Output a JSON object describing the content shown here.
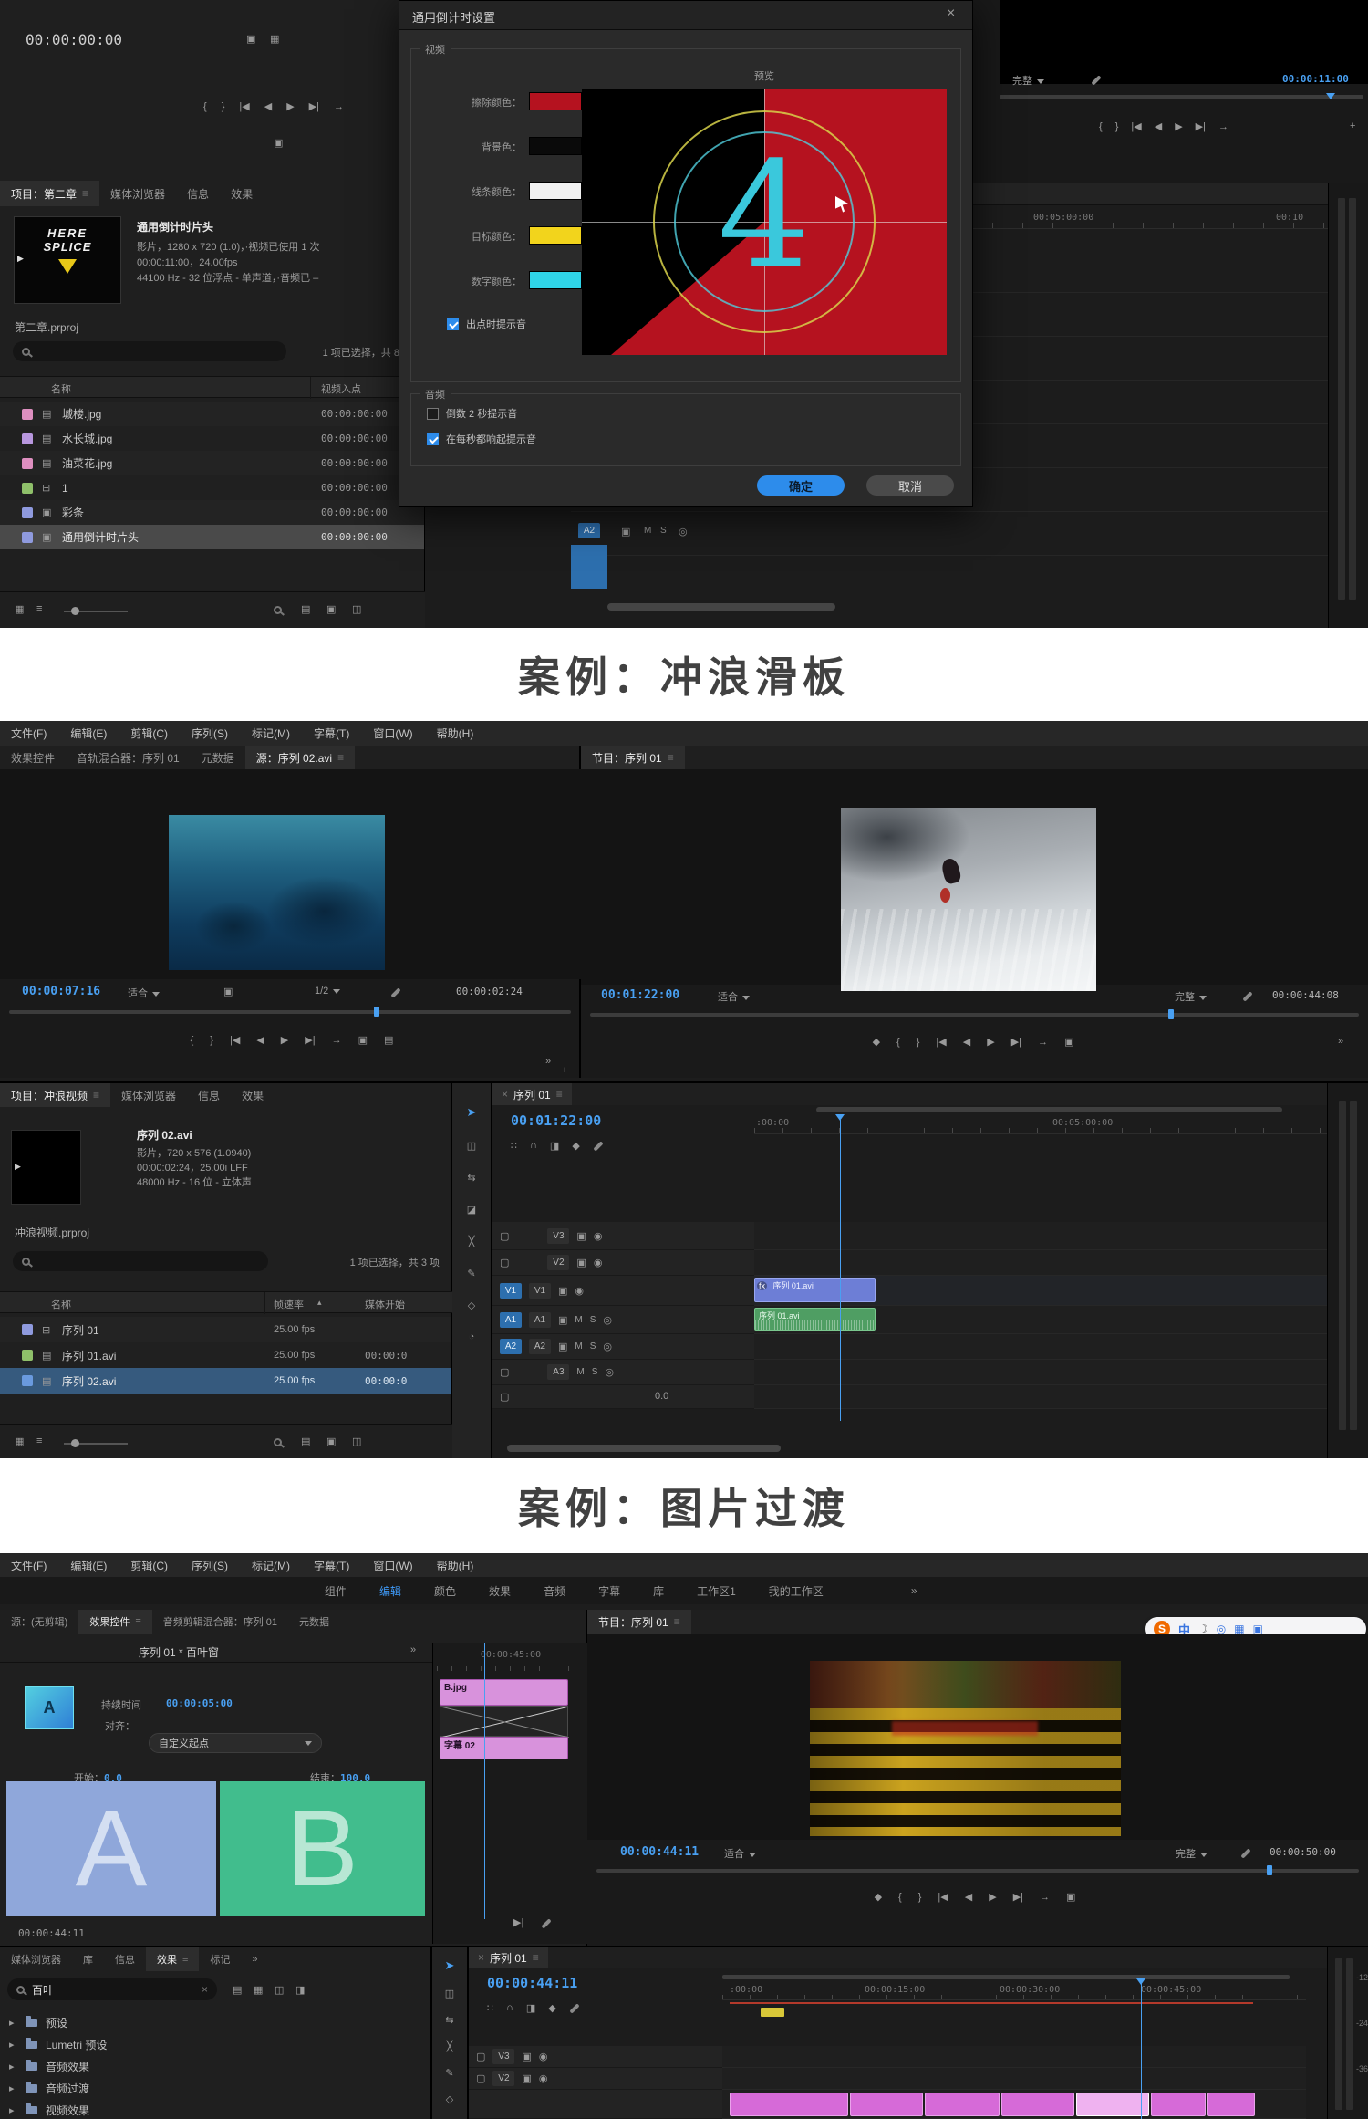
{
  "colors": {
    "accent_blue": "#2d8ceb",
    "timecode_blue": "#49a0f2",
    "countdown_red": "#b5121f",
    "digit_cyan": "#2fd4e8",
    "clip_purple": "#6d7ed6",
    "clip_audio_green": "#4f9e63",
    "clip_pink": "#d66ad8",
    "preview_a_blue": "#8fa7da",
    "preview_b_green": "#41bd8d",
    "sogou_orange": "#f06a00"
  },
  "ui": {
    "menu_icon": "≡",
    "close": "×",
    "more": "»",
    "plus": "+",
    "caret_up": "▴",
    "arrow_right": "▸",
    "lock": "▢",
    "eye": "◉",
    "mic": "◎",
    "cam": "▣",
    "film": "▤",
    "seq": "⊟",
    "mute": "M",
    "solo": "S",
    "fx": "fx",
    "play": "▶",
    "step": "▶|",
    "transport": [
      "{",
      "}",
      "|◀",
      "◀",
      "▶",
      "▶|",
      "→"
    ],
    "transport_b": [
      "◆",
      "{",
      "}",
      "|◀",
      "◀",
      "▶",
      "▶|",
      "→",
      "▣"
    ],
    "tl_icons": [
      "∷",
      "∩",
      "◨",
      "◆"
    ],
    "tools": [
      "➤",
      "◫",
      "⇆",
      "◪",
      "╳",
      "✎",
      "◇",
      "◔"
    ],
    "panel_icons": [
      "▦",
      "≡"
    ],
    "bin_icons": [
      "▤",
      "▣",
      "◫"
    ],
    "filter_icons": [
      "▤",
      "▦",
      "◫",
      "◨"
    ]
  },
  "divider1": "案例：冲浪滑板",
  "divider2": "案例：图片过渡",
  "s1": {
    "timecode": "00:00:00:00",
    "tabs": [
      "项目：第二章",
      "媒体浏览器",
      "信息",
      "效果"
    ],
    "thumb": {
      "line1": "HERE",
      "line2": "SPLICE"
    },
    "info": {
      "title": "通用倒计时片头",
      "line1": "影片，1280 x 720 (1.0)，·视频已使用 1 次",
      "line2": "00:00:11:00，24.00fps",
      "line3": "44100 Hz - 32 位浮点 - 单声道，·音频已 –",
      "file": "第二章.prproj",
      "selection": "1 项已选择，共 8 项"
    },
    "table": {
      "col_name": "名称",
      "col_in": "视频入点",
      "rows": [
        {
          "name": "城楼.jpg",
          "tin": "00:00:00:00",
          "chip": "#de8fc0"
        },
        {
          "name": "水长城.jpg",
          "tin": "00:00:00:00",
          "chip": "#b897de"
        },
        {
          "name": "油菜花.jpg",
          "tin": "00:00:00:00",
          "chip": "#de8fc0"
        },
        {
          "name": "1",
          "tin": "00:00:00:00",
          "chip": "#8fc06a"
        },
        {
          "name": "彩条",
          "tin": "00:00:00:00",
          "chip": "#8f9ade"
        },
        {
          "name": "通用倒计时片头",
          "tin": "00:00:00:00",
          "chip": "#8f9ade"
        }
      ]
    },
    "dialog": {
      "title": "通用倒计时设置",
      "group_video": "视频",
      "preview_label": "预览",
      "rows": [
        {
          "label": "擦除颜色：",
          "hex": "#b5121f"
        },
        {
          "label": "背景色：",
          "hex": "#0a0a0a"
        },
        {
          "label": "线条颜色：",
          "hex": "#f0f0f0"
        },
        {
          "label": "目标颜色：",
          "hex": "#f2d41c"
        },
        {
          "label": "数字颜色：",
          "hex": "#2fd4e8"
        }
      ],
      "digit": "4",
      "chk_out": "出点时提示音",
      "group_audio": "音频",
      "chk_2s": "倒数 2 秒提示音",
      "chk_each": "在每秒都响起提示音",
      "ok": "确定",
      "cancel": "取消"
    },
    "right": {
      "quality": "完整",
      "timecode": "00:00:11:00",
      "ruler_a": "00:05:00:00",
      "ruler_b": "00:10",
      "track": "A2"
    }
  },
  "s2": {
    "menu": [
      "文件(F)",
      "编辑(E)",
      "剪辑(C)",
      "序列(S)",
      "标记(M)",
      "字幕(T)",
      "窗口(W)",
      "帮助(H)"
    ],
    "left_tabs": [
      "效果控件",
      "音轨混合器：序列 01",
      "元数据",
      "源：序列 02.avi"
    ],
    "source": {
      "timecode": "00:00:07:16",
      "fit": "适合",
      "zoom": "1/2",
      "duration": "00:00:02:24"
    },
    "program_tab": "节目：序列 01",
    "program": {
      "timecode": "00:01:22:00",
      "fit": "适合",
      "quality": "完整",
      "duration": "00:00:44:08"
    },
    "sogou": {
      "logo": "S",
      "items": [
        "中",
        "☽",
        "◎",
        "▦",
        "▣"
      ]
    },
    "project": {
      "tabs": [
        "项目：冲浪视频",
        "媒体浏览器",
        "信息",
        "效果"
      ],
      "clip": "序列 02.avi",
      "line1": "影片，720 x 576 (1.0940)",
      "line2": "00:00:02:24，25.00i LFF",
      "line3": "48000 Hz - 16 位 - 立体声",
      "file": "冲浪视频.prproj",
      "selection": "1 项已选择，共 3 项",
      "col_name": "名称",
      "col_rate": "帧速率",
      "col_start": "媒体开始",
      "rows": [
        {
          "name": "序列 01",
          "rate": "25.00 fps",
          "start": "",
          "chip": "#8f9ade"
        },
        {
          "name": "序列 01.avi",
          "rate": "25.00 fps",
          "start": "00:00:0",
          "chip": "#8fc06a"
        },
        {
          "name": "序列 02.avi",
          "rate": "25.00 fps",
          "start": "00:00:0",
          "chip": "#6a9ade"
        }
      ]
    },
    "timeline": {
      "tab": "序列 01",
      "timecode": "00:01:22:00",
      "ruler_a": ":00:00",
      "ruler_b": "00:05:00:00",
      "v3": "V3",
      "v2": "V2",
      "v1": "V1",
      "a1": "A1",
      "a2": "A2",
      "a3": "A3",
      "clip_video": "序列 01.avi",
      "clip_audio": "序列 01.avi",
      "gain": "0.0"
    }
  },
  "s3": {
    "menu": [
      "文件(F)",
      "编辑(E)",
      "剪辑(C)",
      "序列(S)",
      "标记(M)",
      "字幕(T)",
      "窗口(W)",
      "帮助(H)"
    ],
    "workspaces": [
      "组件",
      "编辑",
      "颜色",
      "效果",
      "音频",
      "字幕",
      "库",
      "工作区1",
      "我的工作区"
    ],
    "left_tabs": [
      "源：(无剪辑)",
      "效果控件",
      "音频剪辑混合器：序列 01",
      "元数据"
    ],
    "fx": {
      "header": "序列 01 * 百叶窗",
      "dur_label": "持续时间",
      "dur_value": "00:00:05:00",
      "align_label": "对齐：",
      "align_value": "自定义起点",
      "start_label": "开始：",
      "start_value": "0.0",
      "end_label": "结束：",
      "end_value": "100.0",
      "a": "A",
      "b": "B",
      "mini_time": "00:00:45:00",
      "clip_b": "B.jpg",
      "clip_sub": "字幕 02",
      "timecode": "00:00:44:11"
    },
    "program_tab": "节目：序列 01",
    "program": {
      "timecode": "00:00:44:11",
      "fit": "适合",
      "quality": "完整",
      "duration": "00:00:50:00"
    },
    "effects": {
      "tabs": [
        "媒体浏览器",
        "库",
        "信息",
        "效果",
        "标记"
      ],
      "search": "百叶",
      "tree": [
        "预设",
        "Lumetri 预设",
        "音频效果",
        "音频过渡",
        "视频效果"
      ]
    },
    "timeline": {
      "tab": "序列 01",
      "timecode": "00:00:44:11",
      "r0": ":00:00",
      "r1": "00:00:15:00",
      "r2": "00:00:30:00",
      "r3": "00:00:45:00",
      "v3": "V3",
      "v2": "V2",
      "meter": [
        "-12",
        "-24",
        "-36"
      ]
    }
  }
}
